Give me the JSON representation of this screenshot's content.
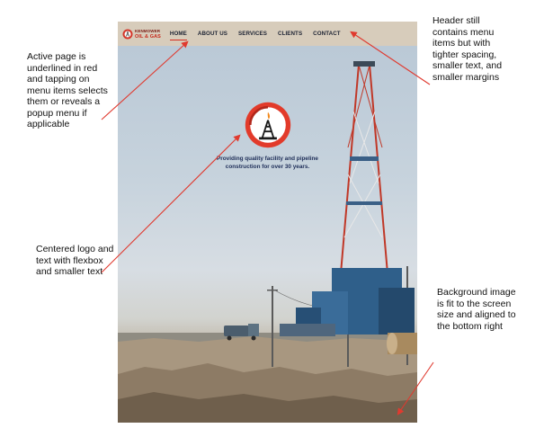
{
  "header": {
    "brand_line1": "KENMOWER",
    "brand_line2": "OIL & GAS",
    "menu": [
      {
        "label": "HOME",
        "active": true
      },
      {
        "label": "ABOUT US",
        "active": false
      },
      {
        "label": "SERVICES",
        "active": false
      },
      {
        "label": "CLIENTS",
        "active": false
      },
      {
        "label": "CONTACT",
        "active": false
      }
    ]
  },
  "hero": {
    "tagline": "Providing quality facility and pipeline construction for over 30 years."
  },
  "annotations": {
    "active_page": "Active page is underlined in red and tapping on menu items selects them or reveals a popup menu if applicable",
    "header_note": "Header still contains menu items but with tighter spacing, smaller text, and smaller margins",
    "centered_note": "Centered logo and text with flexbox and smaller text",
    "background_note": "Background image is fit to the screen size and aligned to the bottom right"
  },
  "colors": {
    "header_bg": "#d7ccbb",
    "active_underline": "#d52b1e",
    "tagline": "#1e2e58",
    "annotation_arrow": "#e03a2f"
  },
  "icons": {
    "brand": "oil-derrick-logo-icon",
    "hero": "oil-derrick-logo-icon"
  }
}
